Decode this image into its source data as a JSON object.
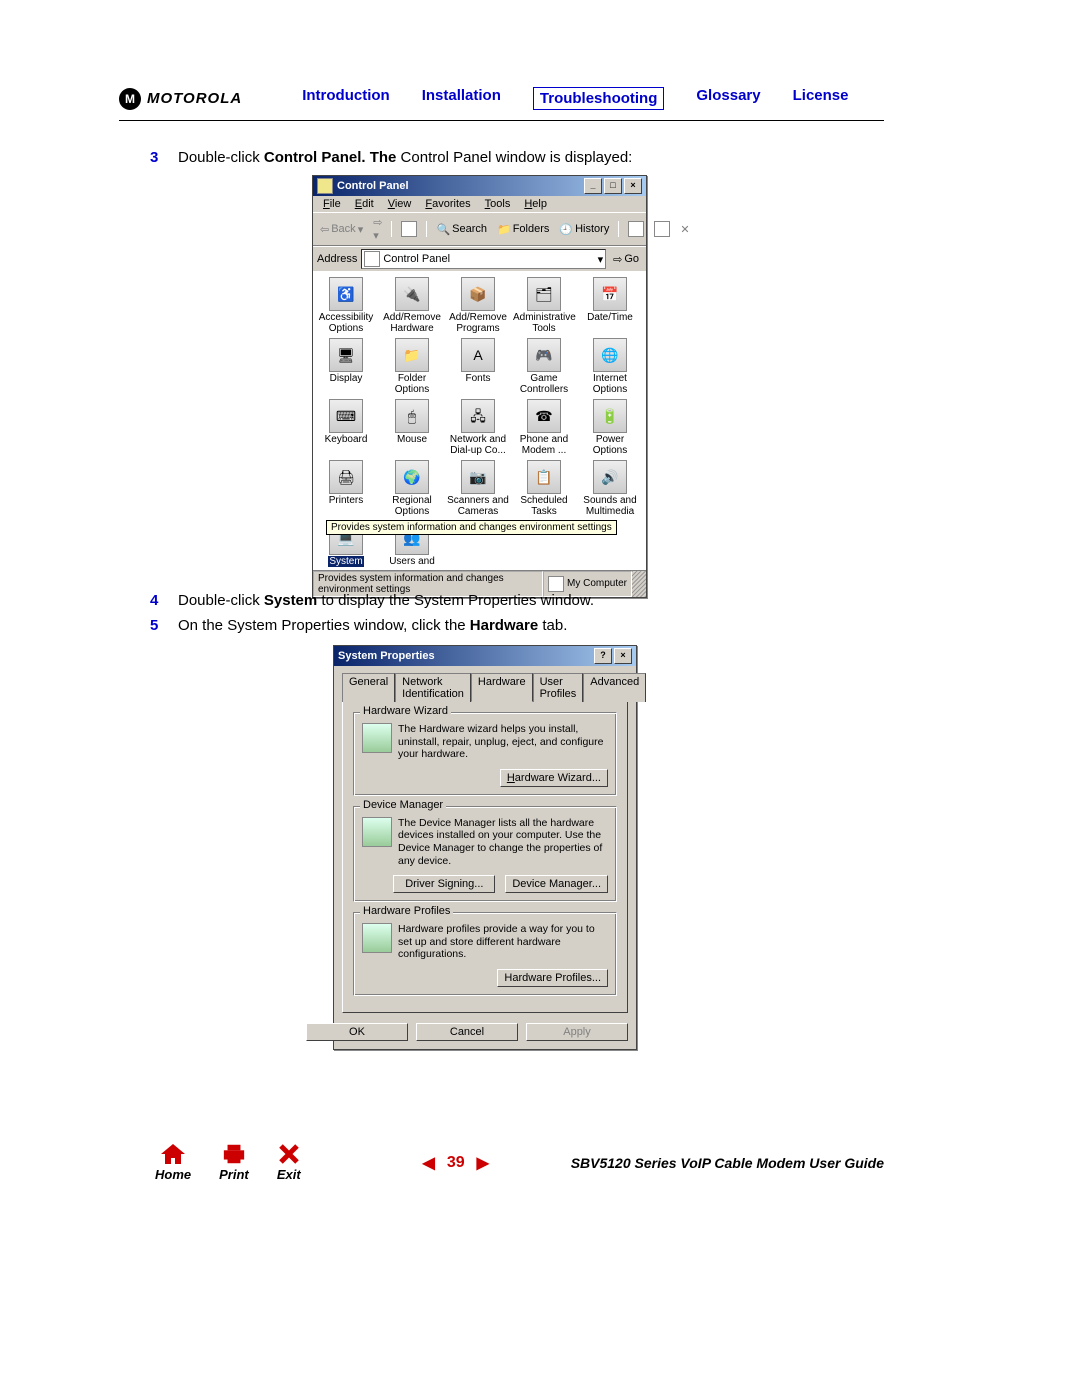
{
  "header": {
    "brand": "MOTOROLA",
    "nav": [
      "Introduction",
      "Installation",
      "Troubleshooting",
      "Glossary",
      "License"
    ],
    "activeIndex": 2
  },
  "steps": {
    "s3": {
      "num": "3",
      "pre": "Double-click ",
      "b": "Control Panel. The",
      "post": " Control Panel window is displayed:"
    },
    "s4": {
      "num": "4",
      "pre": "Double-click ",
      "b": "System",
      "post": " to display the System Properties window."
    },
    "s5": {
      "num": "5",
      "pre": "On the System Properties window, click the ",
      "b": "Hardware",
      "post": " tab."
    }
  },
  "cp": {
    "title": "Control Panel",
    "menus": [
      "File",
      "Edit",
      "View",
      "Favorites",
      "Tools",
      "Help"
    ],
    "toolbar": {
      "back": "Back",
      "search": "Search",
      "folders": "Folders",
      "history": "History"
    },
    "address_label": "Address",
    "address_value": "Control Panel",
    "go": "Go",
    "items": [
      {
        "label": "Accessibility Options",
        "glyph": "♿"
      },
      {
        "label": "Add/Remove Hardware",
        "glyph": "🔌"
      },
      {
        "label": "Add/Remove Programs",
        "glyph": "📦"
      },
      {
        "label": "Administrative Tools",
        "glyph": "🗂"
      },
      {
        "label": "Date/Time",
        "glyph": "📅"
      },
      {
        "label": "Display",
        "glyph": "🖥"
      },
      {
        "label": "Folder Options",
        "glyph": "📁"
      },
      {
        "label": "Fonts",
        "glyph": "A"
      },
      {
        "label": "Game Controllers",
        "glyph": "🎮"
      },
      {
        "label": "Internet Options",
        "glyph": "🌐"
      },
      {
        "label": "Keyboard",
        "glyph": "⌨"
      },
      {
        "label": "Mouse",
        "glyph": "🖱"
      },
      {
        "label": "Network and Dial-up Co...",
        "glyph": "🖧"
      },
      {
        "label": "Phone and Modem ...",
        "glyph": "☎"
      },
      {
        "label": "Power Options",
        "glyph": "🔋"
      },
      {
        "label": "Printers",
        "glyph": "🖨"
      },
      {
        "label": "Regional Options",
        "glyph": "🌍"
      },
      {
        "label": "Scanners and Cameras",
        "glyph": "📷"
      },
      {
        "label": "Scheduled Tasks",
        "glyph": "📋"
      },
      {
        "label": "Sounds and Multimedia",
        "glyph": "🔊"
      },
      {
        "label": "System",
        "glyph": "💻",
        "selected": true
      },
      {
        "label": "Users and",
        "glyph": "👥"
      }
    ],
    "tooltip": "Provides system information and changes environment settings",
    "status_left": "Provides system information and changes environment settings",
    "status_right": "My Computer"
  },
  "sp": {
    "title": "System Properties",
    "tabs": [
      "General",
      "Network Identification",
      "Hardware",
      "User Profiles",
      "Advanced"
    ],
    "activeTab": 2,
    "hw_wizard": {
      "title": "Hardware Wizard",
      "desc": "The Hardware wizard helps you install, uninstall, repair, unplug, eject, and configure your hardware.",
      "btn": "Hardware Wizard..."
    },
    "dev_mgr": {
      "title": "Device Manager",
      "desc": "The Device Manager lists all the hardware devices installed on your computer. Use the Device Manager to change the properties of any device.",
      "btn1": "Driver Signing...",
      "btn2": "Device Manager..."
    },
    "hw_prof": {
      "title": "Hardware Profiles",
      "desc": "Hardware profiles provide a way for you to set up and store different hardware configurations.",
      "btn": "Hardware Profiles..."
    },
    "ok": "OK",
    "cancel": "Cancel",
    "apply": "Apply"
  },
  "footer": {
    "home": "Home",
    "print": "Print",
    "exit": "Exit",
    "page": "39",
    "doc_title": "SBV5120 Series VoIP Cable Modem User Guide"
  }
}
